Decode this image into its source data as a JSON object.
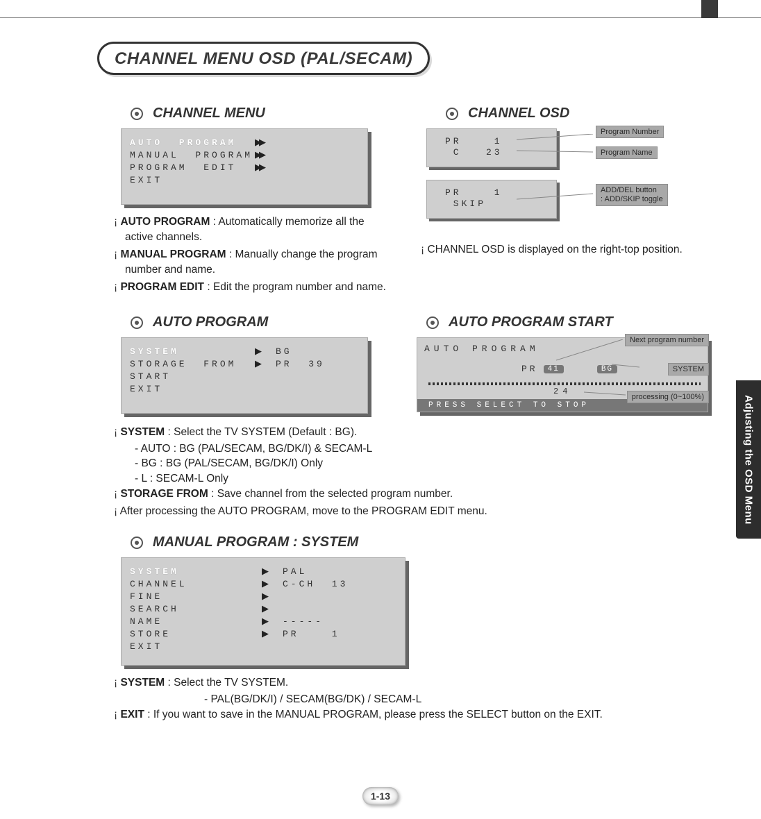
{
  "side_tab": "Adjusting the OSD Menu",
  "title": "CHANNEL MENU OSD (PAL/SECAM)",
  "page_number": "1-13",
  "sec_channel_menu": {
    "heading": "CHANNEL MENU",
    "rows": [
      {
        "label": "AUTO  PROGRAM",
        "hl": true,
        "arr": "▶▶"
      },
      {
        "label": "MANUAL  PROGRAM",
        "arr": "▶▶"
      },
      {
        "label": "PROGRAM  EDIT",
        "arr": "▶▶"
      },
      {
        "label": "EXIT",
        "arr": ""
      }
    ],
    "bullets": [
      {
        "b": "AUTO PROGRAM",
        "t": " : Automatically memorize all the active channels."
      },
      {
        "b": "MANUAL PROGRAM",
        "t": " : Manually change the program number and name."
      },
      {
        "b": "PROGRAM EDIT",
        "t": " : Edit the program number and name."
      }
    ]
  },
  "sec_channel_osd": {
    "heading": "CHANNEL OSD",
    "box1": {
      "r1": "PR    1",
      "r2": " C   23"
    },
    "box2": {
      "r1": "PR    1",
      "r2": " SKIP"
    },
    "labels": {
      "prog_num": "Program Number",
      "prog_name": "Program Name",
      "add_del": "ADD/DEL button\n: ADD/SKIP toggle"
    },
    "bullets": [
      {
        "t": "CHANNEL OSD is displayed on the right-top position."
      }
    ]
  },
  "sec_auto_program": {
    "heading": "AUTO PROGRAM",
    "rows": [
      {
        "label": "SYSTEM",
        "hl": true,
        "arr": "▶",
        "val": "BG"
      },
      {
        "label": "STORAGE  FROM",
        "arr": "▶",
        "val": "PR  39"
      },
      {
        "label": "START",
        "arr": "",
        "val": ""
      },
      {
        "label": "EXIT",
        "arr": "",
        "val": ""
      }
    ],
    "bullets_top": [
      {
        "b": "SYSTEM",
        "t": " : Select the TV SYSTEM (Default : BG)."
      }
    ],
    "subs": [
      "- AUTO : BG (PAL/SECAM, BG/DK/I) & SECAM-L",
      "- BG : BG (PAL/SECAM, BG/DK/I) Only",
      "- L : SECAM-L Only"
    ],
    "bullets_bot": [
      {
        "b": "STORAGE FROM",
        "t": " : Save channel from the selected program number."
      },
      {
        "t": "After processing the AUTO PROGRAM, move to the PROGRAM EDIT menu."
      }
    ]
  },
  "sec_auto_start": {
    "heading": "AUTO PROGRAM START",
    "title_row": "AUTO  PROGRAM",
    "pr_lbl": "PR",
    "pr_val": "41",
    "bg_val": "BG",
    "numline": "24",
    "footer": "PRESS  SELECT  TO  STOP",
    "anno": {
      "next": "Next program number",
      "system": "SYSTEM",
      "processing": "processing (0~100%)"
    }
  },
  "sec_manual": {
    "heading": "MANUAL PROGRAM : SYSTEM",
    "rows": [
      {
        "label": "SYSTEM",
        "hl": true,
        "arr": "▶",
        "val": "PAL"
      },
      {
        "label": "CHANNEL",
        "arr": "▶",
        "val": "C-CH  13"
      },
      {
        "label": "FINE",
        "arr": "▶",
        "val": ""
      },
      {
        "label": "SEARCH",
        "arr": "▶",
        "val": ""
      },
      {
        "label": "NAME",
        "arr": "▶",
        "val": "-----"
      },
      {
        "label": "STORE",
        "arr": "▶",
        "val": "PR    1"
      },
      {
        "label": "EXIT",
        "arr": "",
        "val": ""
      }
    ],
    "bullets": [
      {
        "b": "SYSTEM",
        "t": " : Select the TV SYSTEM."
      }
    ],
    "sub": "- PAL(BG/DK/I) / SECAM(BG/DK) / SECAM-L",
    "bullets2": [
      {
        "b": "EXIT",
        "t": " : If you want to save in the MANUAL PROGRAM, please press the SELECT button on the EXIT."
      }
    ]
  }
}
